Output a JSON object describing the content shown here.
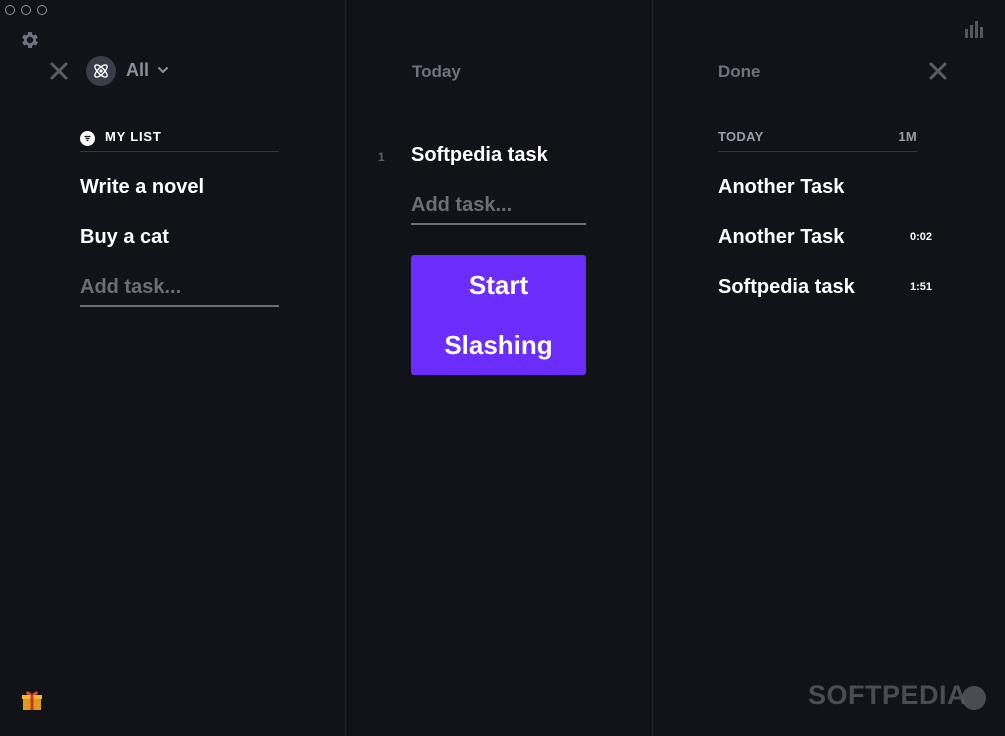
{
  "window": {
    "controls": [
      "close",
      "minimize",
      "maximize"
    ]
  },
  "icons": {
    "settings": "gear-icon",
    "stats": "bar-chart-icon",
    "close": "close-icon",
    "filter_avatar": "atom-icon",
    "filter_chevron": "chevron-down-icon",
    "gift": "gift-icon"
  },
  "colors": {
    "background": "#121318",
    "accent": "#6b2dfc",
    "muted_text": "#6f727d",
    "divider": "#25262d"
  },
  "left": {
    "filter_label": "All",
    "list": {
      "title": "MY LIST",
      "tasks": [
        {
          "label": "Write a novel"
        },
        {
          "label": "Buy a cat"
        }
      ],
      "add_placeholder": "Add task..."
    }
  },
  "today": {
    "title": "Today",
    "tasks": [
      {
        "index": "1",
        "label": "Softpedia task"
      }
    ],
    "add_placeholder": "Add task...",
    "start_button": {
      "line1": "Start",
      "line2": "Slashing"
    }
  },
  "done": {
    "title": "Done",
    "section_label": "TODAY",
    "section_total": "1M",
    "tasks": [
      {
        "label": "Another Task",
        "duration": ""
      },
      {
        "label": "Another Task",
        "duration": "0:02"
      },
      {
        "label": "Softpedia task",
        "duration": "1:51"
      }
    ]
  },
  "watermark": "SOFTPEDIA"
}
